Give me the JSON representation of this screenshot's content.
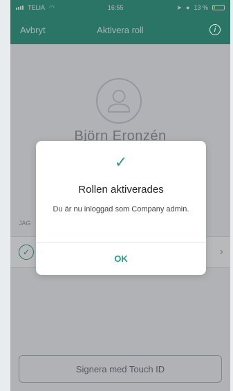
{
  "status_bar": {
    "carrier": "TELIA",
    "time": "16:55",
    "battery_text": "13 %"
  },
  "nav": {
    "cancel_label": "Avbryt",
    "title": "Aktivera roll",
    "info_icon": "i"
  },
  "profile": {
    "name": "Björn Eronzén"
  },
  "roles": {
    "section_label": "JAG"
  },
  "touch_id_button_label": "Signera med Touch ID",
  "alert": {
    "title": "Rollen aktiverades",
    "message": "Du är nu inloggad som Company admin.",
    "ok_label": "OK"
  },
  "colors": {
    "accent": "#2e9a82",
    "battery_low": "#ffd200"
  }
}
